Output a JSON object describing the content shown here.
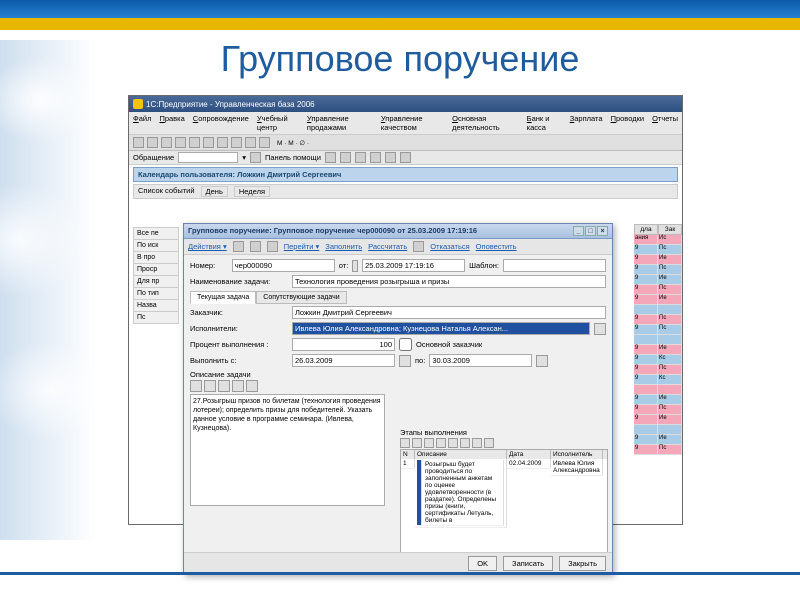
{
  "slide": {
    "title": "Групповое поручение"
  },
  "mainWindow": {
    "title": "1С:Предприятие - Управленческая база 2006",
    "menus": [
      "Файл",
      "Правка",
      "Сопровождение",
      "Учебный центр",
      "Управление продажами",
      "Управление качеством",
      "Основная деятельность",
      "Банк и касса",
      "Зарплата",
      "Проводки",
      "Отчеты"
    ],
    "subbar": {
      "label": "Обращение",
      "panel": "Панель помощи"
    },
    "calendar": "Календарь пользователя: Ложкин Дмитрий Сергеевич",
    "eventbar": {
      "list": "Список событий",
      "day": "День",
      "week": "Неделя"
    },
    "leftTabs": [
      "Все пе",
      "По иск",
      "В про",
      "Проср",
      "Для пр",
      "По тип",
      "Назва",
      "Пс"
    ],
    "rightHead": {
      "c1": "дла",
      "c2": "Зак"
    },
    "rightRows": [
      {
        "cls": "pink",
        "a": "ания",
        "b": "Ис"
      },
      {
        "cls": "blue",
        "a": "9",
        "b": "Пс"
      },
      {
        "cls": "pink",
        "a": "9",
        "b": "Ие"
      },
      {
        "cls": "blue",
        "a": "9",
        "b": "Пс"
      },
      {
        "cls": "blue",
        "a": "9",
        "b": "Ие"
      },
      {
        "cls": "pink",
        "a": "9",
        "b": "Пс"
      },
      {
        "cls": "pink",
        "a": "9",
        "b": "Ие"
      },
      {
        "cls": "blue",
        "a": "",
        "b": ""
      },
      {
        "cls": "pink",
        "a": "9",
        "b": "Пс"
      },
      {
        "cls": "blue",
        "a": "9",
        "b": "Пс"
      },
      {
        "cls": "blue",
        "a": "",
        "b": ""
      },
      {
        "cls": "pink",
        "a": "9",
        "b": "Ие"
      },
      {
        "cls": "blue",
        "a": "9",
        "b": "Кс"
      },
      {
        "cls": "pink",
        "a": "9",
        "b": "Пс"
      },
      {
        "cls": "blue",
        "a": "9",
        "b": "Кс"
      },
      {
        "cls": "pink",
        "a": "",
        "b": ""
      },
      {
        "cls": "blue",
        "a": "9",
        "b": "Ие"
      },
      {
        "cls": "pink",
        "a": "9",
        "b": "Пс"
      },
      {
        "cls": "pink",
        "a": "9",
        "b": "Ие"
      },
      {
        "cls": "blue",
        "a": "",
        "b": ""
      },
      {
        "cls": "blue",
        "a": "9",
        "b": "Ие"
      },
      {
        "cls": "pink",
        "a": "9",
        "b": "Пс"
      }
    ]
  },
  "dialog": {
    "title": "Групповое поручение: Групповое поручение чер000090 от 25.03.2009 17:19:16",
    "toolbar": {
      "actions": "Действия ▾",
      "go": "Перейти ▾",
      "fill": "Заполнить",
      "calc": "Рассчитать",
      "refuse": "Отказаться",
      "notify": "Оповестить"
    },
    "labels": {
      "number": "Номер:",
      "from": "от:",
      "template": "Шаблон:",
      "taskName": "Наименование задачи:",
      "currentTask": "Текущая задача",
      "related": "Сопутствующие задачи",
      "customer": "Заказчик:",
      "executors": "Исполнители:",
      "percent": "Процент выполнения :",
      "mainCustomer": "Основной заказчик",
      "doFrom": "Выполнить с:",
      "to": "по:",
      "descTitle": "Описание задачи",
      "stagesTitle": "Этапы выполнения"
    },
    "values": {
      "number": "чер000090",
      "date": "25.03.2009 17:19:16",
      "template": "",
      "taskName": "Технология проведения розыгрыша и призы",
      "customer": "Ложкин Дмитрий Сергеевич",
      "executors": "Ивлева Юлия Александровна; Кузнецова Наталья Алексан...",
      "percent": "100",
      "from": "26.03.2009",
      "to": "30.03.2009",
      "description": "27.Розыгрыш призов по билетам (технология проведения лотереи); определить призы для победителей. Указать данное условие в программе семинара. (Ивлева, Кузнецова)."
    },
    "stages": {
      "head": {
        "n": "N",
        "desc": "Описание",
        "date": "Дата",
        "exec": "Исполнитель"
      },
      "rows": [
        {
          "n": "1",
          "desc": "Розыгрыш будет проводиться по заполненным анкетам по оценке удовлетворенности (в раздатке). Определены призы (книги, сертификаты Летуаль, билеты в",
          "date": "02.04.2009",
          "exec": "Ивлева Юлия Александровна"
        }
      ]
    },
    "buttons": {
      "ok": "OK",
      "save": "Записать",
      "close": "Закрыть"
    }
  }
}
